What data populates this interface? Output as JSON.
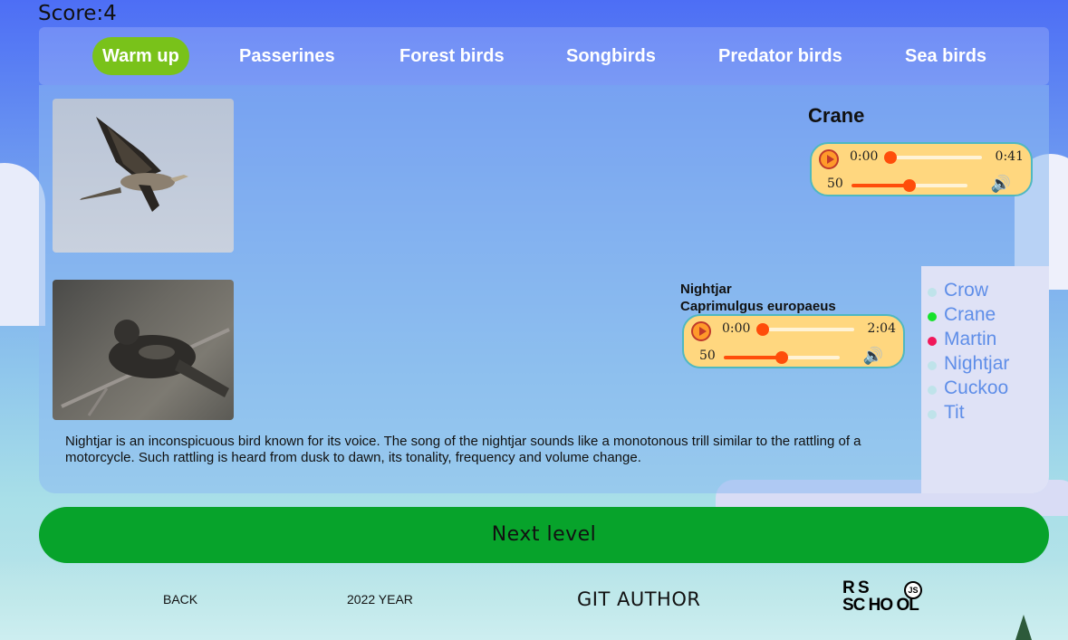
{
  "score": {
    "label": "Score:4"
  },
  "nav": {
    "items": [
      {
        "label": "Warm up",
        "active": true
      },
      {
        "label": "Passerines",
        "active": false
      },
      {
        "label": "Forest birds",
        "active": false
      },
      {
        "label": "Songbirds",
        "active": false
      },
      {
        "label": "Predator birds",
        "active": false
      },
      {
        "label": "Sea birds",
        "active": false
      }
    ]
  },
  "question": {
    "title": "Crane",
    "player": {
      "current": "0:00",
      "duration": "0:41",
      "volume": "50",
      "progress": 0.0,
      "volume_level": 0.5
    }
  },
  "selected": {
    "name": "Nightjar",
    "latin": "Caprimulgus europaeus",
    "player": {
      "current": "0:00",
      "duration": "2:04",
      "volume": "50",
      "progress": 0.0,
      "volume_level": 0.5
    },
    "description": "Nightjar is an inconspicuous bird known for its voice. The song of the nightjar sounds like a monotonous trill similar to the rattling of a motorcycle. Such rattling is heard from dusk to dawn, its tonality, frequency and volume change."
  },
  "answers": [
    {
      "label": "Crow",
      "state": "neutral"
    },
    {
      "label": "Crane",
      "state": "correct"
    },
    {
      "label": "Martin",
      "state": "wrong"
    },
    {
      "label": "Nightjar",
      "state": "neutral"
    },
    {
      "label": "Cuckoo",
      "state": "neutral"
    },
    {
      "label": "Tit",
      "state": "neutral"
    }
  ],
  "next_button": {
    "label": "Next level"
  },
  "footer": {
    "back": "BACK",
    "year": "2022 YEAR",
    "git": "GIT AUTHOR",
    "logo_line1": "R   S",
    "logo_line2": "SC HO OL",
    "logo_badge": "JS"
  },
  "colors": {
    "active_tab": "#79c21a",
    "next_button": "#07a32b",
    "correct": "#16e22b",
    "wrong": "#f0185a",
    "answer_text": "#5f8ee8",
    "player_bg": "#ffd77f",
    "player_accent": "#ff4d0a"
  }
}
